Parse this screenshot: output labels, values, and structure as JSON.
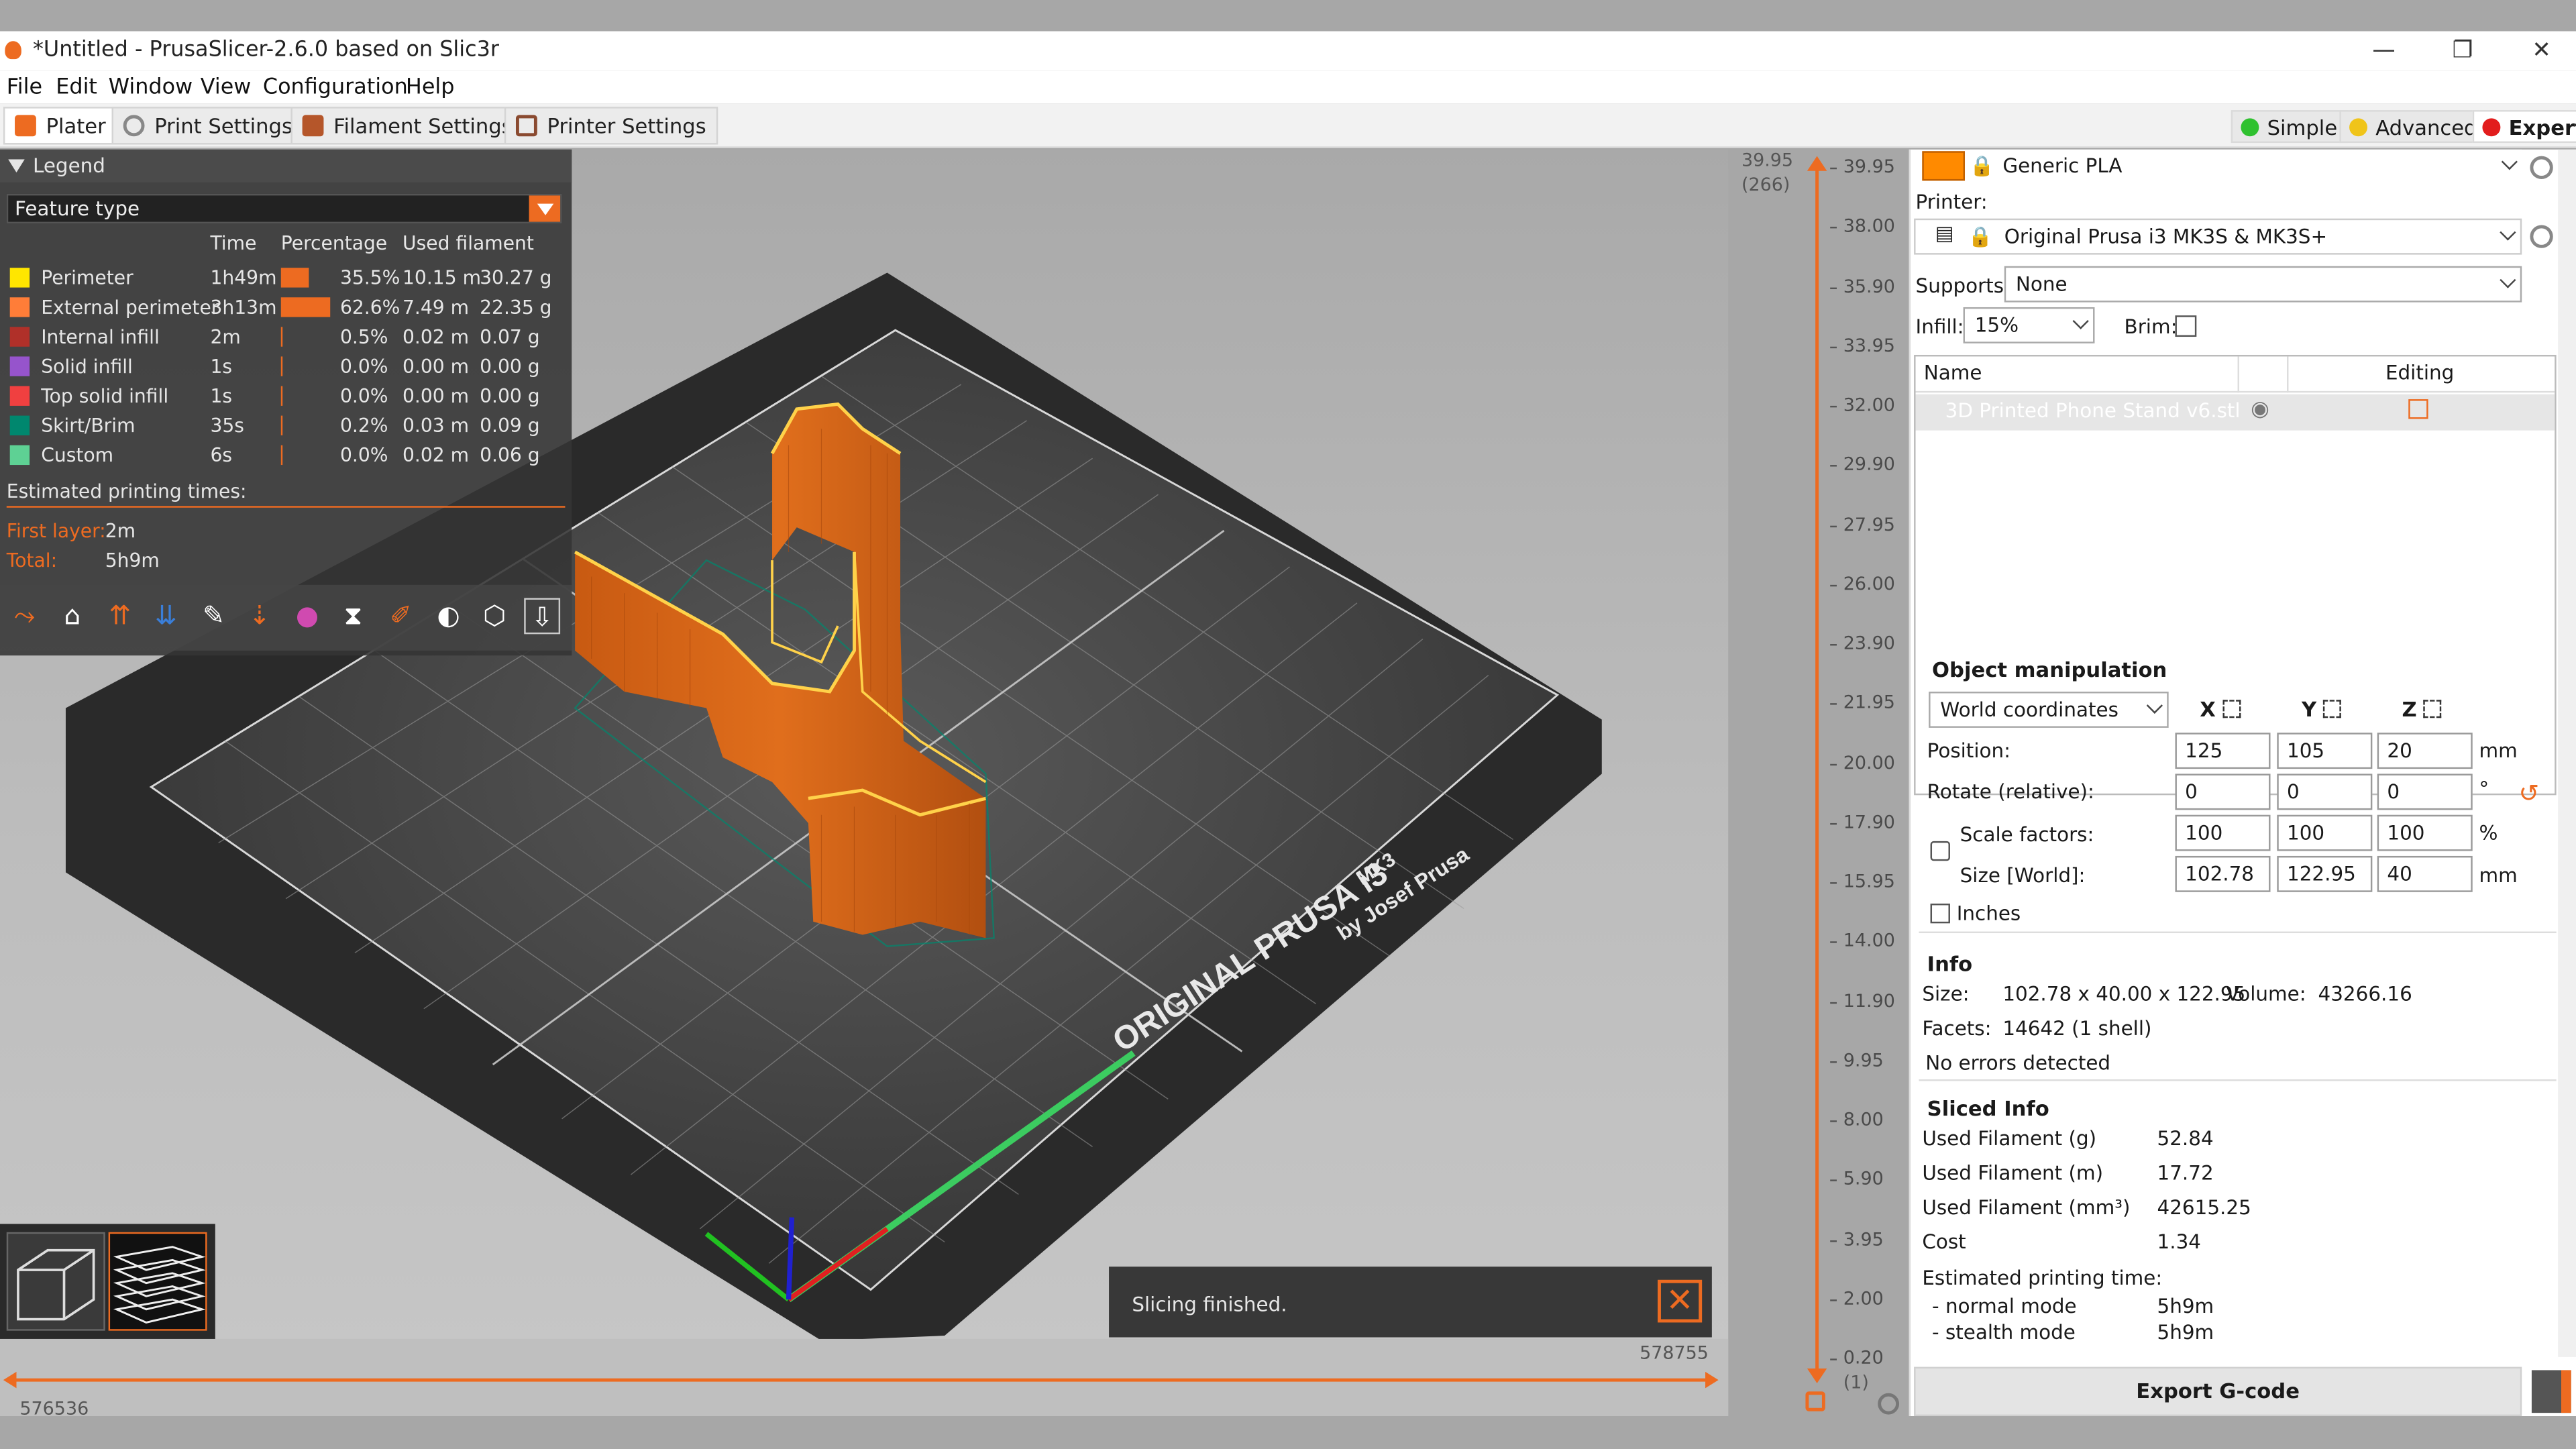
{
  "window": {
    "title": "*Untitled - PrusaSlicer-2.6.0 based on Slic3r",
    "min": "—",
    "max": "❐",
    "close": "✕"
  },
  "menu": [
    "File",
    "Edit",
    "Window",
    "View",
    "Configuration",
    "Help"
  ],
  "tabs": [
    {
      "label": "Plater",
      "color": "#ed6b21"
    },
    {
      "label": "Print Settings",
      "color": "#888888"
    },
    {
      "label": "Filament Settings",
      "color": "#b5562a"
    },
    {
      "label": "Printer Settings",
      "color": "#8a4a30"
    }
  ],
  "modes": [
    {
      "label": "Simple",
      "color": "#2fc12f"
    },
    {
      "label": "Advanced",
      "color": "#f0c419"
    },
    {
      "label": "Expert",
      "color": "#e21d1d"
    }
  ],
  "legend": {
    "title": "Legend",
    "view_type": "Feature type",
    "columns": [
      "Time",
      "Percentage",
      "Used filament"
    ],
    "rows": [
      {
        "name": "Perimeter",
        "color": "#ffe600",
        "time": "1h49m",
        "bar": 0.355,
        "pct": "35.5%",
        "m": "10.15 m",
        "g": "30.27 g"
      },
      {
        "name": "External perimeter",
        "color": "#ff7d38",
        "time": "3h13m",
        "bar": 0.626,
        "pct": "62.6%",
        "m": "7.49 m",
        "g": "22.35 g"
      },
      {
        "name": "Internal infill",
        "color": "#b03029",
        "time": "2m",
        "bar": 0.005,
        "pct": "0.5%",
        "m": "0.02 m",
        "g": "0.07 g"
      },
      {
        "name": "Solid infill",
        "color": "#9654cc",
        "time": "1s",
        "bar": 0.0,
        "pct": "0.0%",
        "m": "0.00 m",
        "g": "0.00 g"
      },
      {
        "name": "Top solid infill",
        "color": "#f04040",
        "time": "1s",
        "bar": 0.0,
        "pct": "0.0%",
        "m": "0.00 m",
        "g": "0.00 g"
      },
      {
        "name": "Skirt/Brim",
        "color": "#00876e",
        "time": "35s",
        "bar": 0.002,
        "pct": "0.2%",
        "m": "0.03 m",
        "g": "0.09 g"
      },
      {
        "name": "Custom",
        "color": "#5ed194",
        "time": "6s",
        "bar": 0.0,
        "pct": "0.0%",
        "m": "0.02 m",
        "g": "0.06 g"
      }
    ],
    "est_label": "Estimated printing times:",
    "first_layer_label": "First layer:",
    "first_layer": "2m",
    "total_label": "Total:",
    "total": "5h9m"
  },
  "toolbar_icons": [
    "travel-icon",
    "shells-icon",
    "retractions-icon",
    "deretractions-icon",
    "seams-icon",
    "tool-changes-icon",
    "color-changes-icon",
    "pause-prints-icon",
    "custom-gcode-icon",
    "center-of-gravity-icon",
    "shells-wireframe-icon",
    "tool-marker-icon"
  ],
  "bed": {
    "label1": "ORIGINAL PRUSA i3",
    "label2": "MK3",
    "label3": "by Josef Prusa"
  },
  "notice": {
    "text": "Slicing finished.",
    "close": "✕"
  },
  "hslider": {
    "right_value": "578755",
    "left_value": "576536"
  },
  "vslider": {
    "top_value": "39.95",
    "top_index": "(266)",
    "bottom_index": "(1)",
    "ticks": [
      "39.95",
      "38.00",
      "35.90",
      "33.95",
      "32.00",
      "29.90",
      "27.95",
      "26.00",
      "23.90",
      "21.95",
      "20.00",
      "17.90",
      "15.95",
      "14.00",
      "11.90",
      "9.95",
      "8.00",
      "5.90",
      "3.95",
      "2.00",
      "0.20"
    ]
  },
  "panel": {
    "filament": {
      "name": "Generic PLA",
      "color": "#ff8a00"
    },
    "printer_label": "Printer:",
    "printer": "Original Prusa i3 MK3S & MK3S+",
    "supports_label": "Supports:",
    "supports": "None",
    "infill_label": "Infill:",
    "infill": "15%",
    "brim_label": "Brim:",
    "list_cols": {
      "name": "Name",
      "editing": "Editing"
    },
    "object_name": "3D Printed Phone Stand v6.stl",
    "om_title": "Object manipulation",
    "coords": "World coordinates",
    "axes": [
      "X",
      "Y",
      "Z"
    ],
    "position_label": "Position:",
    "position": [
      "125",
      "105",
      "20"
    ],
    "position_unit": "mm",
    "rotate_label": "Rotate (relative):",
    "rotate": [
      "0",
      "0",
      "0"
    ],
    "rotate_unit": "°",
    "scale_label": "Scale factors:",
    "scale": [
      "100",
      "100",
      "100"
    ],
    "scale_unit": "%",
    "size_label": "Size [World]:",
    "size": [
      "102.78",
      "122.95",
      "40"
    ],
    "size_unit": "mm",
    "inches_label": "Inches",
    "info_title": "Info",
    "size_info_label": "Size:",
    "size_info": "102.78 x 40.00 x 122.95",
    "volume_label": "Volume:",
    "volume": "43266.16",
    "facets_label": "Facets:",
    "facets": "14642 (1 shell)",
    "errors": "No errors detected",
    "sliced_title": "Sliced Info",
    "sliced": [
      {
        "label": "Used Filament (g)",
        "value": "52.84"
      },
      {
        "label": "Used Filament (m)",
        "value": "17.72"
      },
      {
        "label": "Used Filament (mm³)",
        "value": "42615.25"
      },
      {
        "label": "Cost",
        "value": "1.34"
      }
    ],
    "est_label": "Estimated printing time:",
    "normal_label": "- normal mode",
    "normal": "5h9m",
    "stealth_label": "- stealth mode",
    "stealth": "5h9m",
    "export": "Export G-code"
  }
}
